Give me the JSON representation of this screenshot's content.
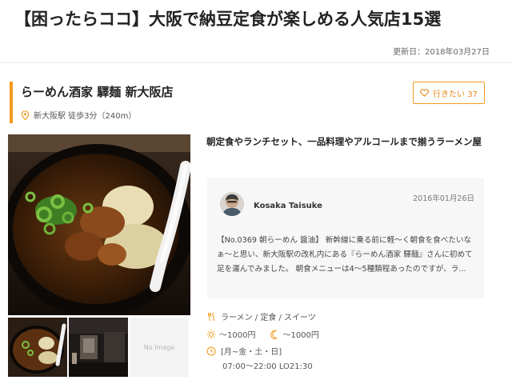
{
  "article": {
    "title": "【困ったらココ】大阪で納豆定食が楽しめる人気店15選",
    "updated": "更新日：2018年03月27日"
  },
  "shop": {
    "name": "らーめん酒家 驛麺 新大阪店",
    "access": "新大阪駅 徒歩3分（240m）",
    "want_label": "行きたい 37",
    "catch": "朝定食やランチセット、一品料理やアルコールまで揃うラーメン屋",
    "no_image": "No Image"
  },
  "review": {
    "reviewer": "Kosaka Taisuke",
    "date": "2016年01月26日",
    "text": "【No.0369 朝らーめん 醤油】 新幹線に乗る前に軽〜く朝食を食べたいなぁ〜と思い、新大阪駅の改札内にある『らーめん酒家 驛麺』さんに初めて足を運んでみました。 朝食メニューは4〜5種類程あったのですが、ラ..."
  },
  "info": {
    "genre": "ラーメン / 定食 / スイーツ",
    "lunch_price": "～1000円",
    "dinner_price": "～1000円",
    "days": "[月~金・土・日]",
    "hours": "07:00～22:00 LO21:30"
  },
  "colors": {
    "accent": "#f29b1f"
  },
  "icons": {
    "location": "location-pin-icon",
    "heart": "heart-icon",
    "genre": "fork-knife-icon",
    "lunch": "sun-icon",
    "dinner": "moon-icon",
    "hours": "clock-icon"
  }
}
